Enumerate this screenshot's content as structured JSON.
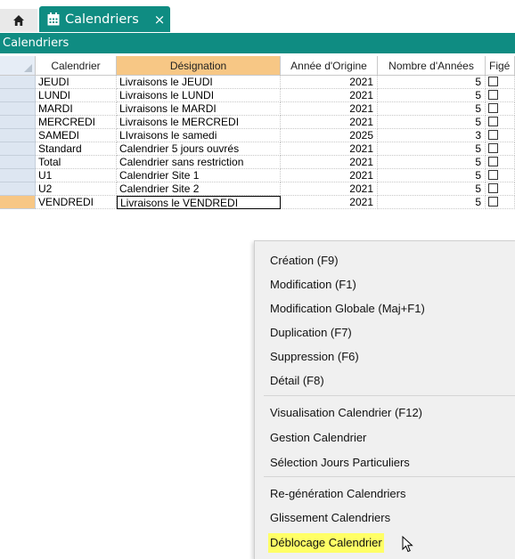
{
  "tabs": {
    "home_icon": "home-icon",
    "active_tab_label": "Calendriers",
    "active_tab_icon": "calendar-icon",
    "close_label": "×"
  },
  "panel": {
    "title": "Calendriers"
  },
  "grid": {
    "columns": [
      "Calendrier",
      "Désignation",
      "Année d'Origine",
      "Nombre d'Années",
      "Figé"
    ],
    "rows": [
      {
        "code": "JEUDI",
        "designation": "Livraisons le JEUDI",
        "annee": "2021",
        "nombre": "5"
      },
      {
        "code": "LUNDI",
        "designation": "Livraisons le LUNDI",
        "annee": "2021",
        "nombre": "5"
      },
      {
        "code": "MARDI",
        "designation": "Livraisons le MARDI",
        "annee": "2021",
        "nombre": "5"
      },
      {
        "code": "MERCREDI",
        "designation": "Livraisons le MERCREDI",
        "annee": "2021",
        "nombre": "5"
      },
      {
        "code": "SAMEDI",
        "designation": "LIvraisons le samedi",
        "annee": "2025",
        "nombre": "3"
      },
      {
        "code": "Standard",
        "designation": "Calendrier 5 jours ouvrés",
        "annee": "2021",
        "nombre": "5"
      },
      {
        "code": "Total",
        "designation": "Calendrier sans restriction",
        "annee": "2021",
        "nombre": "5"
      },
      {
        "code": "U1",
        "designation": "Calendrier Site 1",
        "annee": "2021",
        "nombre": "5"
      },
      {
        "code": "U2",
        "designation": "Calendrier Site 2",
        "annee": "2021",
        "nombre": "5"
      },
      {
        "code": "VENDREDI",
        "designation": "Livraisons le VENDREDI",
        "annee": "2021",
        "nombre": "5"
      }
    ],
    "selected_row": 9
  },
  "context_menu": {
    "groups": [
      [
        "Création (F9)",
        "Modification (F1)",
        "Modification Globale (Maj+F1)",
        "Duplication (F7)",
        "Suppression (F6)",
        "Détail (F8)"
      ],
      [
        "Visualisation Calendrier (F12)",
        "Gestion Calendrier",
        "Sélection Jours Particuliers"
      ],
      [
        "Re-génération Calendriers",
        "Glissement Calendriers",
        "Déblocage Calendrier"
      ]
    ],
    "highlighted": "Déblocage Calendrier"
  },
  "colors": {
    "accent": "#0f8c82",
    "selected_header": "#f7c785",
    "menu_highlight": "#ffff66",
    "row_header": "#dde6f1"
  }
}
